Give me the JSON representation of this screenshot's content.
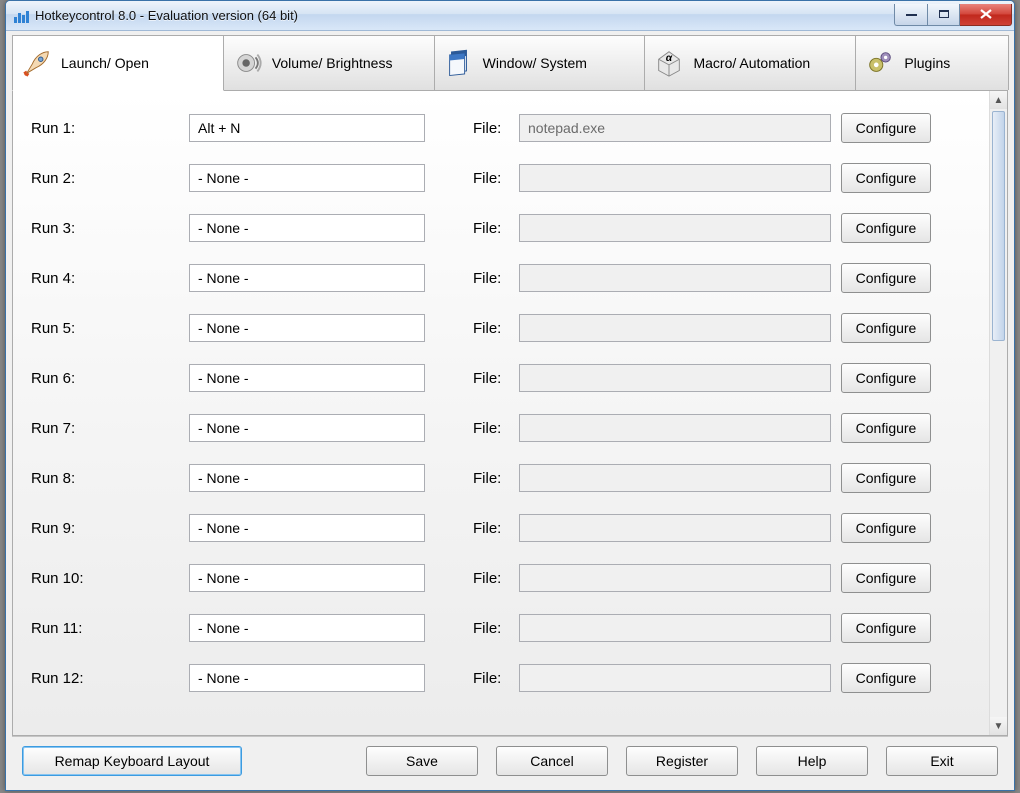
{
  "window": {
    "title": "Hotkeycontrol 8.0 - Evaluation version (64 bit)"
  },
  "tabs": [
    {
      "id": "launch",
      "label": "Launch/ Open",
      "active": true
    },
    {
      "id": "volume",
      "label": "Volume/ Brightness",
      "active": false
    },
    {
      "id": "window",
      "label": "Window/ System",
      "active": false
    },
    {
      "id": "macro",
      "label": "Macro/ Automation",
      "active": false
    },
    {
      "id": "plugins",
      "label": "Plugins",
      "active": false
    }
  ],
  "columns": {
    "file_label": "File:",
    "configure_label": "Configure"
  },
  "rows": [
    {
      "label": "Run 1:",
      "hotkey": "Alt + N",
      "file": "notepad.exe"
    },
    {
      "label": "Run 2:",
      "hotkey": "- None -",
      "file": ""
    },
    {
      "label": "Run 3:",
      "hotkey": "- None -",
      "file": ""
    },
    {
      "label": "Run 4:",
      "hotkey": "- None -",
      "file": ""
    },
    {
      "label": "Run 5:",
      "hotkey": "- None -",
      "file": ""
    },
    {
      "label": "Run 6:",
      "hotkey": "- None -",
      "file": ""
    },
    {
      "label": "Run 7:",
      "hotkey": "- None -",
      "file": ""
    },
    {
      "label": "Run 8:",
      "hotkey": "- None -",
      "file": ""
    },
    {
      "label": "Run 9:",
      "hotkey": "- None -",
      "file": ""
    },
    {
      "label": "Run 10:",
      "hotkey": "- None -",
      "file": ""
    },
    {
      "label": "Run 11:",
      "hotkey": "- None -",
      "file": ""
    },
    {
      "label": "Run 12:",
      "hotkey": "- None -",
      "file": ""
    }
  ],
  "footer": {
    "remap": "Remap Keyboard Layout",
    "save": "Save",
    "cancel": "Cancel",
    "register": "Register",
    "help": "Help",
    "exit": "Exit"
  }
}
